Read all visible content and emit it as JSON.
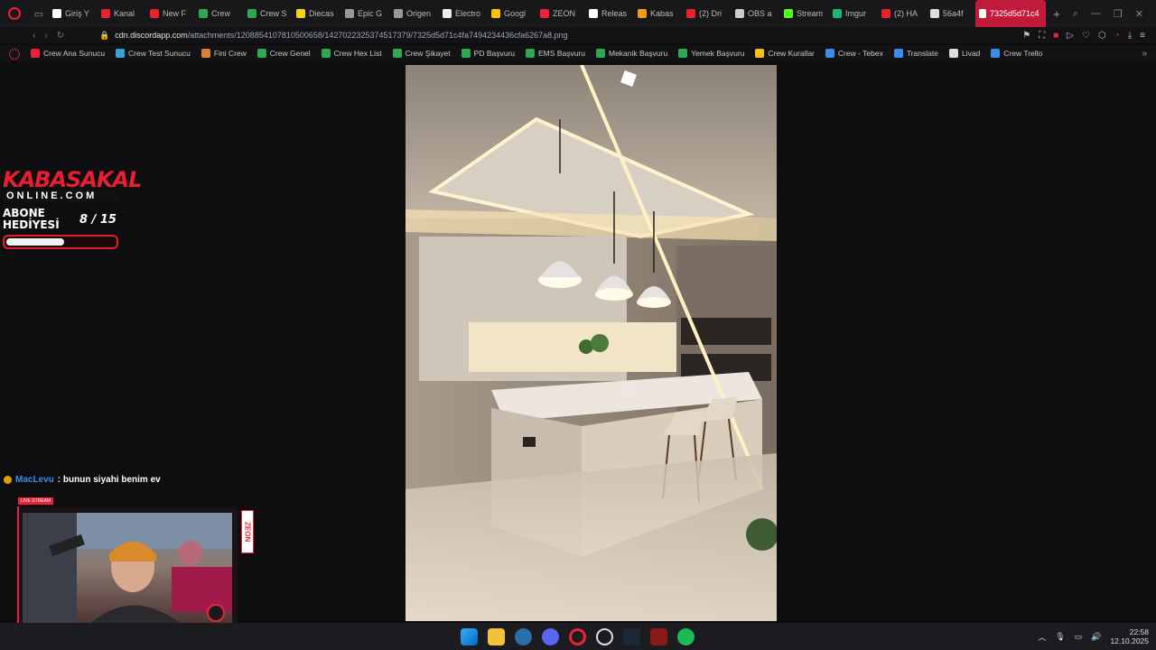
{
  "browser": {
    "tabs": [
      {
        "label": "Giriş Y",
        "color": "#ffffff",
        "icon": "s-icon"
      },
      {
        "label": "Kanal",
        "color": "#e5232b",
        "icon": "youtube-icon"
      },
      {
        "label": "New F",
        "color": "#e5232b",
        "icon": "youtube-icon"
      },
      {
        "label": "Crew",
        "color": "#2fa84f",
        "icon": "plus-icon"
      },
      {
        "label": "Crew S",
        "color": "#2fa84f",
        "icon": "plus-icon"
      },
      {
        "label": "Diecas",
        "color": "#f2d21b",
        "icon": "s-icon"
      },
      {
        "label": "Epic G",
        "color": "#999999",
        "icon": "epic-icon"
      },
      {
        "label": "Origen",
        "color": "#999999",
        "icon": "origen-icon"
      },
      {
        "label": "Electro",
        "color": "#eeeeee",
        "icon": "doc-icon"
      },
      {
        "label": "Googl",
        "color": "#f4c20d",
        "icon": "google-icon"
      },
      {
        "label": "ZEON",
        "color": "#e8233a",
        "icon": "zeon-icon"
      },
      {
        "label": "Releas",
        "color": "#ffffff",
        "icon": "github-icon"
      },
      {
        "label": "Kabas",
        "color": "#f29a1b",
        "icon": "k-icon"
      },
      {
        "label": "(2) Dri",
        "color": "#e5232b",
        "icon": "youtube-icon"
      },
      {
        "label": "OBS a",
        "color": "#cccccc",
        "icon": "obs-icon"
      },
      {
        "label": "Stream",
        "color": "#53fc18",
        "icon": "kick-icon"
      },
      {
        "label": "Imgur",
        "color": "#1bb76e",
        "icon": "imgur-icon"
      },
      {
        "label": "(2) HA",
        "color": "#e5232b",
        "icon": "youtube-icon"
      },
      {
        "label": "56a4f",
        "color": "#dddddd",
        "icon": "file-icon"
      }
    ],
    "active_tab": {
      "label": "7325d5d71c4",
      "color": "#ffffff"
    },
    "new_tab": "+",
    "url_prefix": "cdn.discordapp.com",
    "url_path": "/attachments/1208854107810500658/1427022325374517379/7325d5d71c4fa7494234436cfa6267a8.png"
  },
  "bookmarks": [
    {
      "label": "Crew Ana Sunucu",
      "color": "#e8233a"
    },
    {
      "label": "Crew Test Sunucu",
      "color": "#3aa0d8"
    },
    {
      "label": "Fini Crew",
      "color": "#d8823a"
    },
    {
      "label": "Crew Genel",
      "color": "#2fa84f"
    },
    {
      "label": "Crew Hex List",
      "color": "#2fa84f"
    },
    {
      "label": "Crew Şikayet",
      "color": "#2fa84f"
    },
    {
      "label": "PD Başvuru",
      "color": "#2fa84f"
    },
    {
      "label": "EMS Başvuru",
      "color": "#2fa84f"
    },
    {
      "label": "Mekanik Başvuru",
      "color": "#2fa84f"
    },
    {
      "label": "Yemek Başvuru",
      "color": "#2fa84f"
    },
    {
      "label": "Crew Kurallar",
      "color": "#f2c21b"
    },
    {
      "label": "Crew - Tebex",
      "color": "#3a8ee8"
    },
    {
      "label": "Translate",
      "color": "#3a8ee8"
    },
    {
      "label": "Livad",
      "color": "#dddddd"
    },
    {
      "label": "Crew Trello",
      "color": "#3a8ee8"
    }
  ],
  "overlay": {
    "brand_line1": "KABASAKAL",
    "brand_line2": "ONLINE.COM",
    "sub_label": "ABONE HEDİYESİ",
    "sub_count": "8  / 15",
    "sub_progress": 0.53
  },
  "chat": {
    "user": "MacLevu",
    "message": ": bunun siyahi benim ev"
  },
  "webcam": {
    "label": "LIVE STREAM",
    "side_tag": "ZEON"
  },
  "taskbar": {
    "time": "22:58",
    "date": "12.10.2025"
  }
}
